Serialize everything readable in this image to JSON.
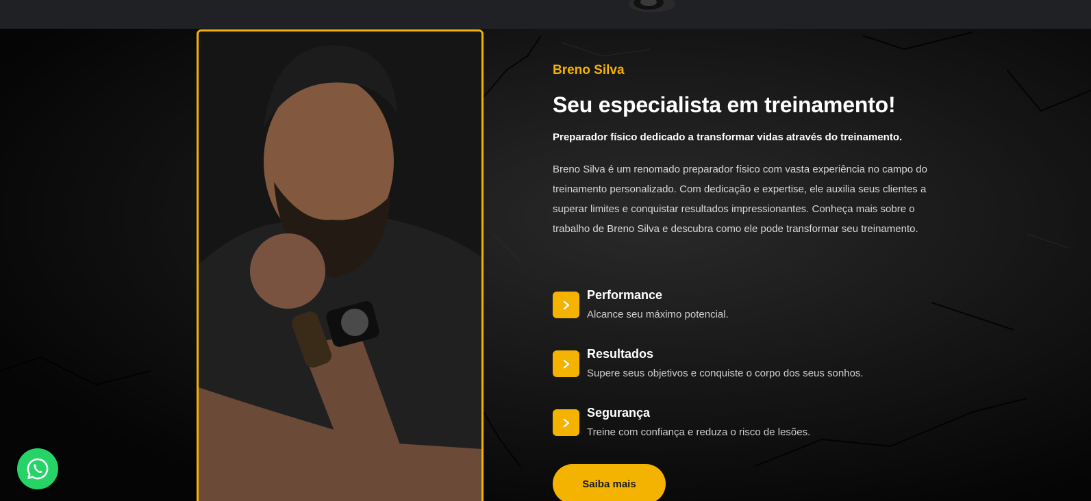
{
  "about": {
    "eyebrow": "Breno Silva",
    "title": "Seu especialista em treinamento!",
    "lead": "Preparador físico dedicado a transformar vidas através do treinamento.",
    "description": "Breno Silva é um renomado preparador físico com vasta experiência no campo do treinamento personalizado. Com dedicação e expertise, ele auxilia seus clientes a superar limites e conquistar resultados impressionantes. Conheça mais sobre o trabalho de Breno Silva e descubra como ele pode transformar seu treinamento.",
    "features": [
      {
        "title": "Performance",
        "description": "Alcance seu máximo potencial.",
        "icon": "chevron-right-icon"
      },
      {
        "title": "Resultados",
        "description": "Supere seus objetivos e conquiste o corpo dos seus sonhos.",
        "icon": "chevron-right-icon"
      },
      {
        "title": "Segurança",
        "description": "Treine com confiança e reduza o risco de lesões.",
        "icon": "chevron-right-icon"
      }
    ],
    "cta_label": "Saiba mais"
  },
  "floating": {
    "icon": "whatsapp-icon"
  },
  "colors": {
    "accent": "#f5b301",
    "background": "#0b0b0b",
    "header": "#1f2125",
    "whatsapp": "#25d366"
  }
}
